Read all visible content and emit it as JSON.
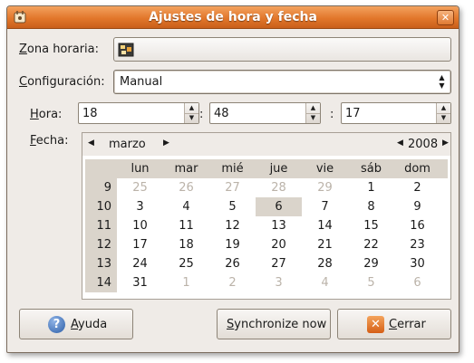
{
  "window": {
    "title": "Ajustes de hora y fecha"
  },
  "timezone": {
    "label_prefix": "",
    "label_mnemonic": "Z",
    "label_rest": "ona horaria:"
  },
  "config": {
    "label_mnemonic": "C",
    "label_rest": "onfiguración:",
    "value": "Manual"
  },
  "time": {
    "label_mnemonic": "H",
    "label_rest": "ora:",
    "hour": "18",
    "minute": "48",
    "second": "17",
    "separator": ":"
  },
  "date": {
    "label_mnemonic": "F",
    "label_rest": "echa:",
    "month": "marzo",
    "year": "2008",
    "weekday_headers": [
      "lun",
      "mar",
      "mié",
      "jue",
      "vie",
      "sáb",
      "dom"
    ],
    "weeks": [
      {
        "number": "9",
        "days": [
          "25",
          "26",
          "27",
          "28",
          "29",
          "1",
          "2"
        ],
        "other": [
          true,
          true,
          true,
          true,
          true,
          false,
          false
        ]
      },
      {
        "number": "10",
        "days": [
          "3",
          "4",
          "5",
          "6",
          "7",
          "8",
          "9"
        ],
        "other": [
          false,
          false,
          false,
          false,
          false,
          false,
          false
        ]
      },
      {
        "number": "11",
        "days": [
          "10",
          "11",
          "12",
          "13",
          "14",
          "15",
          "16"
        ],
        "other": [
          false,
          false,
          false,
          false,
          false,
          false,
          false
        ]
      },
      {
        "number": "12",
        "days": [
          "17",
          "18",
          "19",
          "20",
          "21",
          "22",
          "23"
        ],
        "other": [
          false,
          false,
          false,
          false,
          false,
          false,
          false
        ]
      },
      {
        "number": "13",
        "days": [
          "24",
          "25",
          "26",
          "27",
          "28",
          "29",
          "30"
        ],
        "other": [
          false,
          false,
          false,
          false,
          false,
          false,
          false
        ]
      },
      {
        "number": "14",
        "days": [
          "31",
          "1",
          "2",
          "3",
          "4",
          "5",
          "6"
        ],
        "other": [
          false,
          true,
          true,
          true,
          true,
          true,
          true
        ]
      }
    ],
    "selected_day": "6"
  },
  "buttons": {
    "help": {
      "mnemonic": "A",
      "pre": "",
      "rest": "yuda"
    },
    "sync": {
      "mnemonic": "S",
      "pre": "",
      "rest": "ynchronize now"
    },
    "close": {
      "mnemonic": "C",
      "pre": "",
      "rest": "errar"
    }
  },
  "icons": {
    "title": "clock-settings-icon",
    "timezone": "timezone-map-icon",
    "help": "help-icon",
    "close": "close-icon"
  },
  "colors": {
    "titlebar": "#e2772b",
    "window_bg": "#efebe7",
    "selected_day_bg": "#dad4cb"
  }
}
